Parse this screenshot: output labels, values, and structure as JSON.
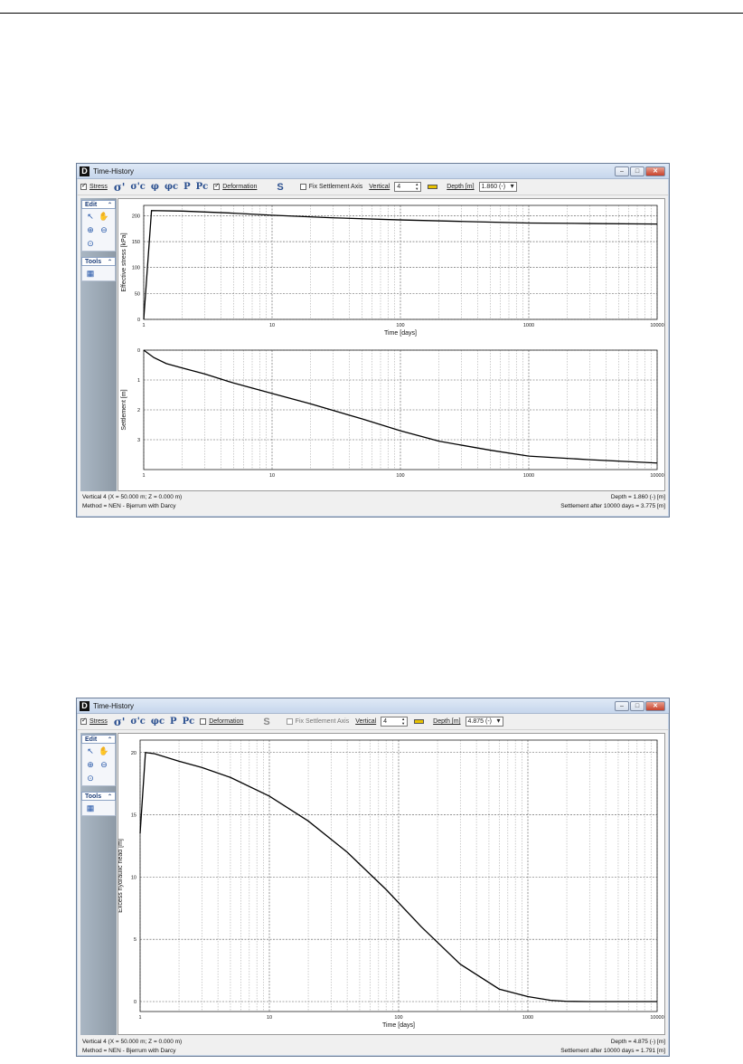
{
  "window1": {
    "title": "Time-History",
    "app_icon": "D",
    "toolbar": {
      "stress_label": "Stress",
      "stress_checked": true,
      "symbols": [
        "σ'",
        "σ'c",
        "φ",
        "φc",
        "P",
        "Pc"
      ],
      "deformation_label": "Deformation",
      "deformation_checked": true,
      "s_button": "S",
      "fix_settlement_label": "Fix Settlement Axis",
      "vertical_label": "Vertical",
      "vertical_value": "4",
      "depth_label": "Depth [m]",
      "depth_value": "1.860 (-)"
    },
    "panel": {
      "edit_label": "Edit",
      "tools_label": "Tools"
    },
    "status": {
      "left1": "Vertical 4 (X = 50.000 m; Z = 0.000 m)",
      "left2": "Method = NEN - Bjerrum with Darcy",
      "right1": "Depth = 1.860 (-) [m]",
      "right2": "Settlement after 10000 days = 3.775 [m]"
    }
  },
  "window2": {
    "title": "Time-History",
    "app_icon": "D",
    "toolbar": {
      "stress_label": "Stress",
      "stress_checked": true,
      "symbols": [
        "σ'",
        "σ'c",
        "φc",
        "P",
        "Pc"
      ],
      "deformation_label": "Deformation",
      "deformation_checked": false,
      "s_button": "S",
      "fix_settlement_label": "Fix Settlement Axis",
      "vertical_label": "Vertical",
      "vertical_value": "4",
      "depth_label": "Depth [m]",
      "depth_value": "4.875 (-)"
    },
    "panel": {
      "edit_label": "Edit",
      "tools_label": "Tools"
    },
    "status": {
      "left1": "Vertical 4 (X = 50.000 m; Z = 0.000 m)",
      "left2": "Method = NEN - Bjerrum with Darcy",
      "right1": "Depth = 4.875 (-) [m]",
      "right2": "Settlement after 10000 days = 1.791 [m]"
    }
  },
  "chart_data": [
    {
      "type": "line",
      "ylabel": "Effective stress [kPa]",
      "xlabel": "Time [days]",
      "xscale": "log",
      "xlim": [
        1,
        10000
      ],
      "ylim": [
        0,
        220
      ],
      "xticks": [
        "1",
        "10",
        "100",
        "1000",
        "10000"
      ],
      "yticks": [
        "0",
        "50",
        "100",
        "150",
        "200"
      ],
      "grid": true,
      "series": [
        {
          "x": [
            1,
            1.15,
            2,
            5,
            10,
            30,
            100,
            300,
            1000,
            3000,
            10000
          ],
          "y": [
            0,
            210,
            209,
            205,
            201,
            196,
            192,
            189,
            186,
            185,
            184
          ]
        }
      ]
    },
    {
      "type": "line",
      "ylabel": "Settlement [m]",
      "xlabel": "",
      "xscale": "log",
      "xlim": [
        1,
        10000
      ],
      "ylim": [
        4,
        0
      ],
      "xticks": [
        "1",
        "10",
        "100",
        "1000",
        "10000"
      ],
      "yticks": [
        "0",
        "1",
        "2",
        "3"
      ],
      "grid": true,
      "series": [
        {
          "x": [
            1,
            1.2,
            1.5,
            2,
            3,
            5,
            10,
            20,
            50,
            100,
            200,
            500,
            1000,
            3000,
            10000
          ],
          "y": [
            0,
            0.25,
            0.45,
            0.6,
            0.8,
            1.1,
            1.45,
            1.8,
            2.3,
            2.7,
            3.05,
            3.35,
            3.55,
            3.67,
            3.78
          ]
        }
      ]
    },
    {
      "type": "line",
      "ylabel": "Excess hydraulic head [m]",
      "xlabel": "Time [days]",
      "xscale": "log",
      "xlim": [
        1,
        10000
      ],
      "ylim": [
        -0.8,
        21
      ],
      "xticks": [
        "1",
        "10",
        "100",
        "1000",
        "10000"
      ],
      "yticks": [
        "0",
        "5",
        "10",
        "15",
        "20"
      ],
      "grid": true,
      "series": [
        {
          "x": [
            1,
            1.1,
            1.3,
            2,
            3,
            5,
            10,
            20,
            40,
            80,
            150,
            300,
            600,
            1000,
            1500,
            2000,
            3000,
            10000
          ],
          "y": [
            13.5,
            20,
            19.9,
            19.3,
            18.8,
            18.0,
            16.5,
            14.5,
            12.0,
            9.0,
            6.0,
            3.0,
            1.0,
            0.4,
            0.1,
            0.02,
            0,
            0
          ]
        }
      ]
    }
  ]
}
